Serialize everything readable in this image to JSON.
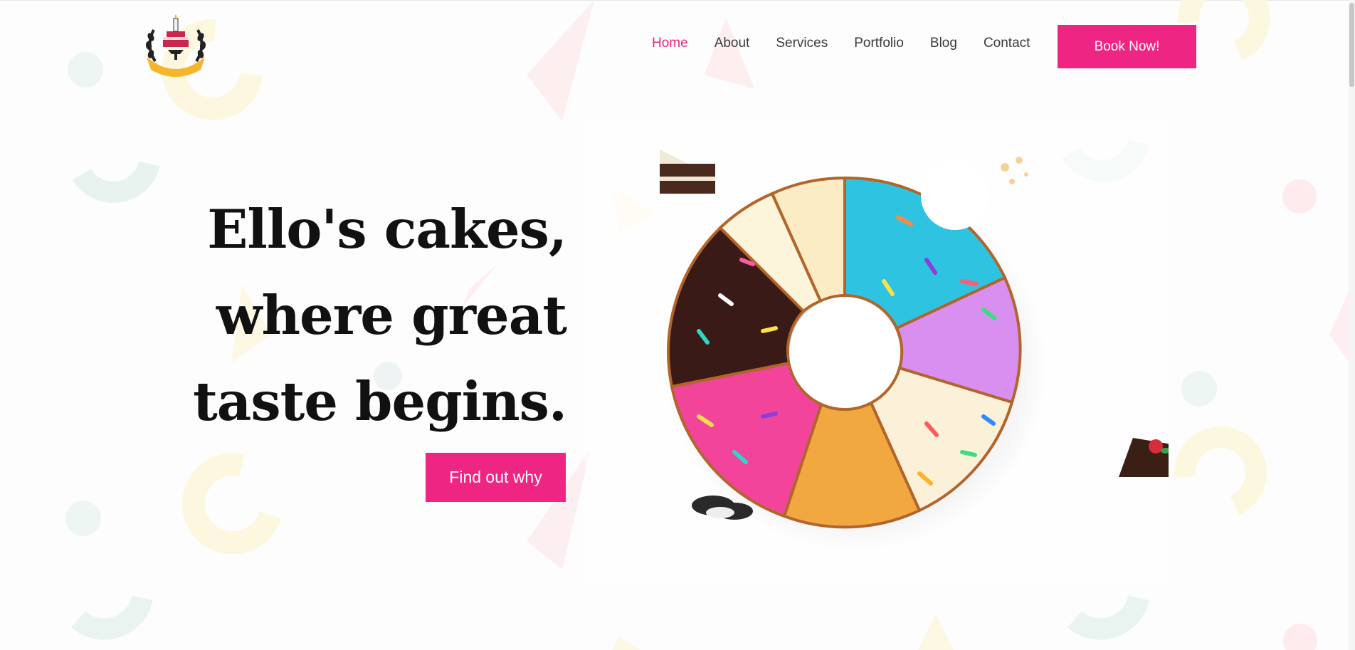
{
  "header": {
    "logo_icon": "bakery-crest-logo",
    "nav": [
      {
        "label": "Home",
        "active": true
      },
      {
        "label": "About",
        "active": false
      },
      {
        "label": "Services",
        "active": false
      },
      {
        "label": "Portfolio",
        "active": false
      },
      {
        "label": "Blog",
        "active": false
      },
      {
        "label": "Contact",
        "active": false
      }
    ],
    "book_label": "Book Now!"
  },
  "hero": {
    "title_lines": [
      "Ello's cakes,",
      "where great",
      "taste begins."
    ],
    "cta_label": "Find out why",
    "image_icon": "sliced-donut-illustration"
  },
  "theme": {
    "accent": "#ee2583",
    "nav_active": "#e6267c",
    "text": "#111111"
  }
}
